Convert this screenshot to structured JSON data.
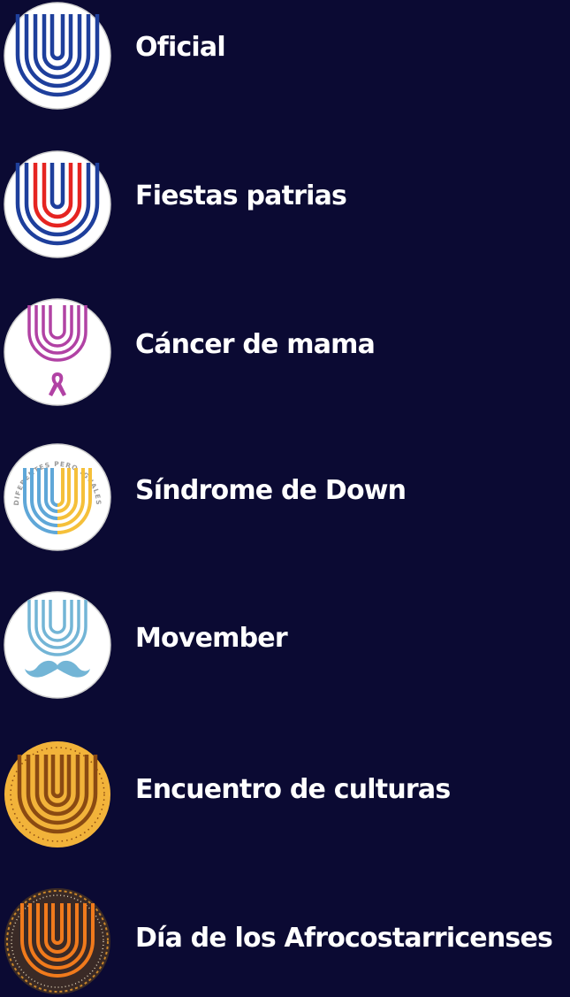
{
  "theme_options": [
    {
      "label": "Oficial",
      "icon": "ucr-logo-official-icon",
      "colors": {
        "background": "#ffffff",
        "stripes": "#1e3f9c"
      }
    },
    {
      "label": "Fiestas patrias",
      "icon": "ucr-logo-flag-icon",
      "colors": {
        "background": "#ffffff",
        "outer": "#1e3f9c",
        "inner": "#e52421"
      }
    },
    {
      "label": "Cáncer de mama",
      "icon": "ucr-logo-pink-ribbon-icon",
      "colors": {
        "background": "#ffffff",
        "stripes": "#b142a4"
      }
    },
    {
      "label": "Síndrome de Down",
      "icon": "ucr-logo-down-syndrome-icon",
      "colors": {
        "background": "#ffffff",
        "left": "#5fa7d8",
        "right": "#f5c03a",
        "text": "#9a9a9a"
      },
      "ring_text": "DIFERENTES PERO IGUALES"
    },
    {
      "label": "Movember",
      "icon": "ucr-logo-mustache-icon",
      "colors": {
        "background": "#ffffff",
        "stripes": "#73b5d6"
      }
    },
    {
      "label": "Encuentro de culturas",
      "icon": "ucr-logo-cultures-icon",
      "colors": {
        "background": "#f2b33a",
        "stripes": "#8a4a12"
      }
    },
    {
      "label": "Día de los Afrocostarricenses",
      "icon": "ucr-logo-afro-icon",
      "colors": {
        "background": "#3a2a26",
        "stripes": "#f07a1c"
      }
    }
  ]
}
